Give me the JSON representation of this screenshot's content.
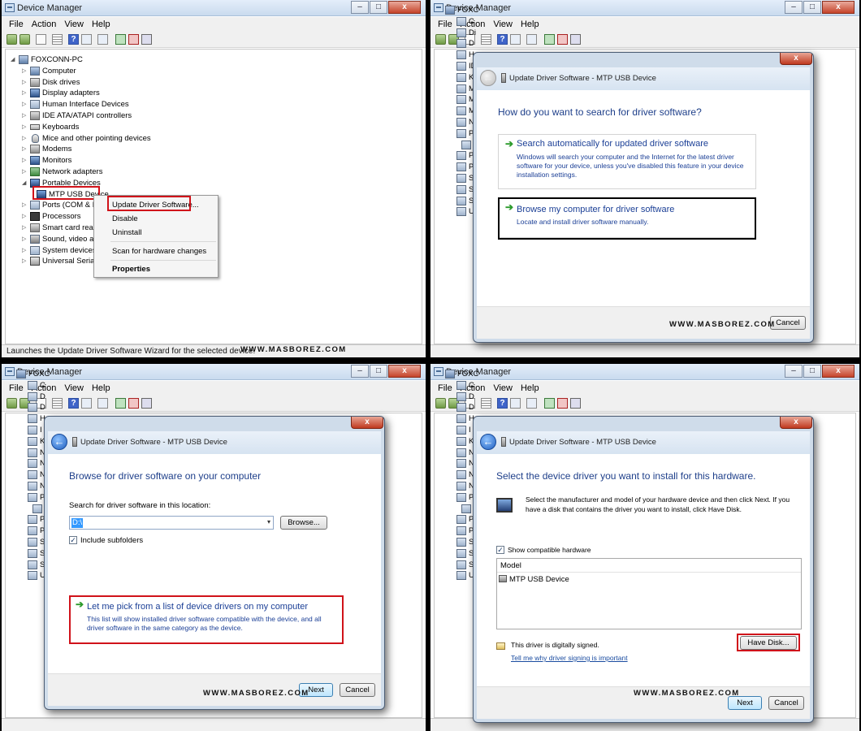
{
  "window": {
    "title": "Device Manager",
    "caption": {
      "minimize": "–",
      "maximize": "□",
      "close": "x"
    }
  },
  "menu": [
    "File",
    "Action",
    "View",
    "Help"
  ],
  "toolbar": {
    "help": "?"
  },
  "watermark": "WWW.MASBOREZ.COM",
  "tree": {
    "root": "FOXCONN-PC",
    "items": [
      "Computer",
      "Disk drives",
      "Display adapters",
      "Human Interface Devices",
      "IDE ATA/ATAPI controllers",
      "Keyboards",
      "Mice and other pointing devices",
      "Modems",
      "Monitors",
      "Network adapters",
      "Portable Devices",
      "Ports (COM & LPT",
      "Processors",
      "Smart card readers",
      "Sound, video and g",
      "System devices",
      "Universal Serial Bus"
    ],
    "child": "MTP USB Device",
    "expand_collapsed": "▷",
    "expand_open": "◢"
  },
  "context_menu": {
    "update": "Update Driver Software...",
    "disable": "Disable",
    "uninstall": "Uninstall",
    "scan": "Scan for hardware changes",
    "properties": "Properties"
  },
  "status_text": "Launches the Update Driver Software Wizard for the selected device.",
  "bg_tree": {
    "p2": {
      "root": "FOXC",
      "letters": [
        "C",
        "Di",
        "D",
        "H",
        "ID",
        "Ke",
        "M",
        "M",
        "M",
        "N",
        "P",
        "",
        "Po",
        "Pr",
        "Sr",
        "Sc",
        "Sy",
        "Ur"
      ]
    },
    "p3": {
      "root": "FOXC",
      "letters": [
        "C",
        "D",
        "D",
        "H",
        "I",
        "K",
        "N",
        "N",
        "N",
        "N",
        "P",
        "",
        "P",
        "P",
        "S",
        "S",
        "S",
        "U"
      ]
    },
    "p4": {
      "root": "FOXC",
      "letters": [
        "C",
        "D",
        "D",
        "H",
        "I",
        "K",
        "N",
        "N",
        "N",
        "N",
        "P",
        "",
        "P",
        "P",
        "S",
        "S",
        "S",
        "U"
      ]
    }
  },
  "wizard": {
    "title": "Update Driver Software - MTP USB Device",
    "close": "x",
    "back": "←",
    "arrow": "➔",
    "step1": {
      "heading": "How do you want to search for driver software?",
      "opt1_title": "Search automatically for updated driver software",
      "opt1_desc": "Windows will search your computer and the Internet for the latest driver software for your device, unless you've disabled this feature in your device installation settings.",
      "opt2_title": "Browse my computer for driver software",
      "opt2_desc": "Locate and install driver software manually."
    },
    "step2": {
      "heading": "Browse for driver software on your computer",
      "search_label": "Search for driver software in this location:",
      "path_value": "D:\\",
      "combo_arrow": "▾",
      "browse": "Browse...",
      "include_subfolders": "Include subfolders",
      "pick_title": "Let me pick from a list of device drivers on my computer",
      "pick_desc": "This list will show installed driver software compatible with the device, and all driver software in the same category as the device."
    },
    "step3": {
      "heading": "Select the device driver you want to install for this hardware.",
      "description": "Select the manufacturer and model of your hardware device and then click Next. If you have a disk that contains the driver you want to install, click Have Disk.",
      "show_compatible": "Show compatible hardware",
      "model_header": "Model",
      "model_item": "MTP USB Device",
      "signed": "This driver is digitally signed.",
      "signing_link": "Tell me why driver signing is important",
      "have_disk": "Have Disk..."
    },
    "next": "Next",
    "cancel": "Cancel",
    "check_mark": "✓"
  },
  "colors": {
    "highlight_red": "#d0121a",
    "link_blue": "#1b3f96",
    "heading_blue": "#1e3f8a"
  }
}
